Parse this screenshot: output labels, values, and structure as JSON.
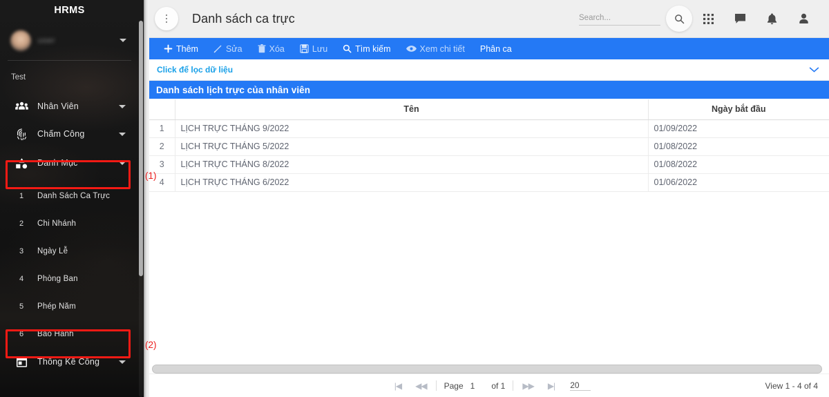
{
  "sidebar": {
    "brand": "HRMS",
    "profile": {
      "name": "user",
      "caret": "chevron-down-icon"
    },
    "section_label": "Test",
    "items": [
      {
        "label": "Nhân Viên",
        "icon": "people-group-icon",
        "has_caret": true
      },
      {
        "label": "Chấm Công",
        "icon": "fingerprint-icon",
        "has_caret": true
      },
      {
        "label": "Danh Mục",
        "icon": "category-shapes-icon",
        "has_caret": true,
        "highlighted": true
      }
    ],
    "sub_items": [
      {
        "num": "1",
        "label": "Danh Sách Ca Trực"
      },
      {
        "num": "2",
        "label": "Chi Nhánh"
      },
      {
        "num": "3",
        "label": "Ngày Lễ"
      },
      {
        "num": "4",
        "label": "Phòng Ban"
      },
      {
        "num": "5",
        "label": "Phép Năm"
      },
      {
        "num": "6",
        "label": "Bảo Hành",
        "highlighted": true
      }
    ],
    "bottom_item": {
      "label": "Thống Kê Công",
      "icon": "calendar-icon",
      "has_caret": true
    }
  },
  "topbar": {
    "menu_icon": "kebab-menu-icon",
    "title": "Danh sách ca trực",
    "search": {
      "value": "",
      "placeholder": "Search..."
    },
    "search_icon": "search-icon",
    "icons": [
      {
        "name": "apps-grid-icon"
      },
      {
        "name": "chat-bubble-icon"
      },
      {
        "name": "bell-icon"
      },
      {
        "name": "person-icon"
      }
    ]
  },
  "toolbar": {
    "buttons": [
      {
        "label": "Thêm",
        "icon": "plus-icon",
        "enabled": true
      },
      {
        "label": "Sửa",
        "icon": "pencil-icon",
        "enabled": false
      },
      {
        "label": "Xóa",
        "icon": "trash-icon",
        "enabled": false
      },
      {
        "label": "Lưu",
        "icon": "save-icon",
        "enabled": false
      },
      {
        "label": "Tìm kiếm",
        "icon": "search-icon",
        "enabled": true
      },
      {
        "label": "Xem chi tiết",
        "icon": "eye-icon",
        "enabled": false
      },
      {
        "label": "Phân ca",
        "icon": "",
        "enabled": true
      }
    ]
  },
  "filterbar": {
    "label": "Click để lọc dữ liệu",
    "chevron": "chevron-down-icon"
  },
  "grid": {
    "title": "Danh sách lịch trực của nhân viên",
    "columns": [
      "",
      "Tên",
      "Ngày bắt đầu"
    ],
    "rows": [
      {
        "num": "1",
        "name": "LỊCH TRỰC THÁNG 9/2022",
        "date": "01/09/2022"
      },
      {
        "num": "2",
        "name": "LỊCH TRỰC THÁNG 5/2022",
        "date": "01/08/2022"
      },
      {
        "num": "3",
        "name": "LỊCH TRỰC THÁNG 8/2022",
        "date": "01/08/2022"
      },
      {
        "num": "4",
        "name": "LỊCH TRỰC THÁNG 6/2022",
        "date": "01/06/2022"
      }
    ]
  },
  "pager": {
    "first_icon": "first-page-icon",
    "prev_icon": "prev-page-icon",
    "page_label": "Page",
    "page_number": "1",
    "of_label": "of 1",
    "next_icon": "next-page-icon",
    "last_icon": "last-page-icon",
    "page_size": "20",
    "view_text": "View 1 - 4 of 4"
  },
  "annotations": [
    {
      "label": "(1)"
    },
    {
      "label": "(2)"
    }
  ],
  "colors": {
    "accent_blue": "#2479f5",
    "filter_link": "#18a0e8",
    "highlight_red": "#f41a14",
    "sidebar_bg": "#151515"
  }
}
